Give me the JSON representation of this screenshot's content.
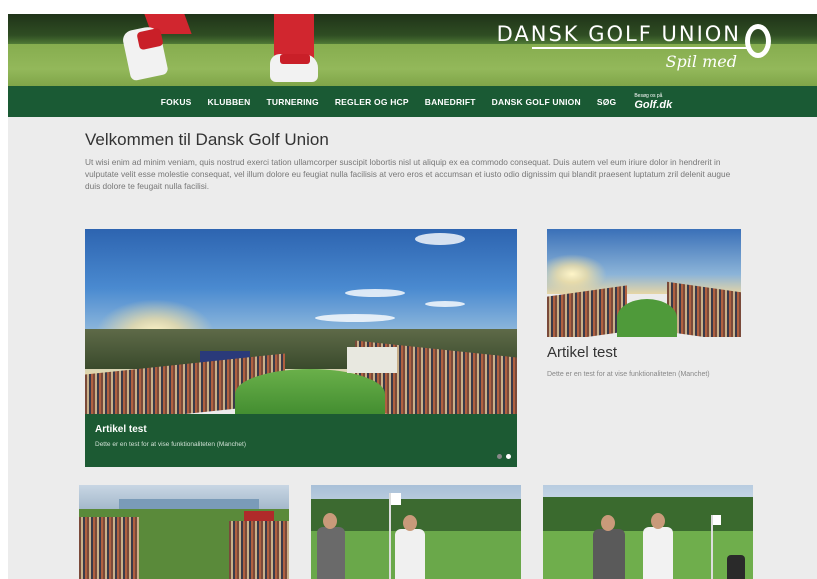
{
  "hero": {
    "brand_name": "DANSK GOLF UNION",
    "brand_tagline": "Spil med"
  },
  "nav": {
    "items": [
      "FOKUS",
      "KLUBBEN",
      "TURNERING",
      "REGLER OG HCP",
      "BANEDRIFT",
      "DANSK GOLF UNION",
      "SØG"
    ],
    "golfdk_prefix": "Besøg os på",
    "golfdk_logo": "Golf.dk"
  },
  "intro": {
    "title": "Velkommen til Dansk Golf Union",
    "text": "Ut wisi enim ad minim veniam, quis nostrud exerci tation ullamcorper suscipit lobortis nisl ut aliquip ex ea commodo consequat. Duis autem vel eum iriure dolor in hendrerit in vulputate velit esse molestie consequat, vel illum dolore eu feugiat nulla facilisis at vero eros et accumsan et iusto odio dignissim qui blandit praesent luptatum zril delenit augue duis dolore te feugait nulla facilisi."
  },
  "featured": {
    "title": "Artikel test",
    "subtitle": "Dette er en test for at vise funktionaliteten (Manchet)",
    "slide_index": 2,
    "slide_count": 2
  },
  "side_article": {
    "title": "Artikel test",
    "desc": "Dette er en test for at vise funktionaliteten (Manchet)"
  },
  "colors": {
    "nav_green": "#1a5a34",
    "caption_green": "#1c5a33",
    "page_bg": "#ececec"
  }
}
